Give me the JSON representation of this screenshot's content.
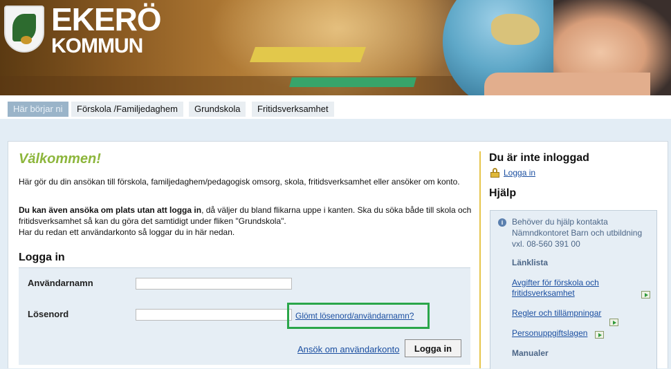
{
  "header": {
    "brand_line1": "EKERÖ",
    "brand_line2": "KOMMUN"
  },
  "tabs": [
    {
      "label": "Här börjar ni",
      "active": true
    },
    {
      "label": "Förskola /Familjedaghem"
    },
    {
      "label": "Grundskola"
    },
    {
      "label": "Fritidsverksamhet"
    }
  ],
  "main": {
    "welcome": "Välkommen!",
    "intro": "Här gör du din ansökan till förskola, familjedaghem/pedagogisk omsorg, skola, fritidsverksamhet eller ansöker om konto.",
    "para2_bold": "Du kan även ansöka om plats utan att logga in",
    "para2_rest": ", då väljer du bland flikarna uppe i kanten. Ska du söka både till skola och fritidsverksamhet så kan du göra det samtidigt under fliken \"Grundskola\".",
    "para3": "Har du redan ett användarkonto så loggar du in här nedan."
  },
  "login": {
    "title": "Logga in",
    "username_label": "Användarnamn",
    "username_value": "",
    "password_label": "Lösenord",
    "password_value": "",
    "forgot_link": "Glömt lösenord/användarnamn?",
    "apply_link": "Ansök om användarkonto",
    "submit_label": "Logga in"
  },
  "sidebar": {
    "status_title": "Du är inte inloggad",
    "login_link": "Logga in",
    "help_title": "Hjälp",
    "help_text": "Behöver du hjälp kontakta Nämndkontoret Barn och utbildning vxl. 08-560 391 00",
    "links_title": "Länklista",
    "links": [
      "Avgifter för förskola och fritidsverksamhet",
      "Regler och tillämpningar",
      "Personuppgiftslagen"
    ],
    "manuals_title": "Manualer"
  },
  "colors": {
    "welcome": "#8db63c",
    "link": "#1a4ea0",
    "highlight_border": "#2aa64a",
    "active_tab": "#9ab4c9",
    "divider": "#e7c54b"
  }
}
